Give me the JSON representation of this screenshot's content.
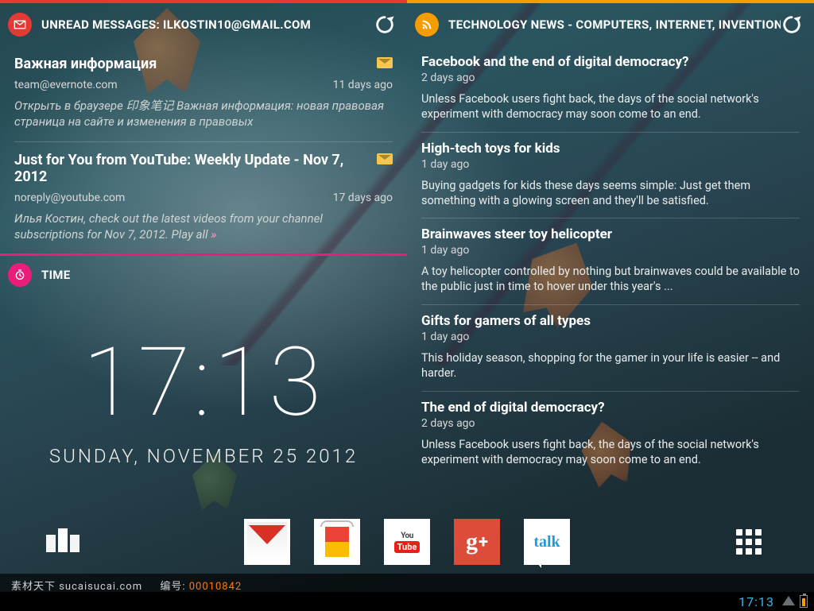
{
  "left": {
    "messages": {
      "header": "UNREAD MESSAGES: ILKOSTIN10@GMAIL.COM",
      "items": [
        {
          "title": "Важная информация",
          "from": "team@evernote.com",
          "age": "11 days ago",
          "preview": "Открыть в браузере 印象笔记 Важная информация: новая правовая страница на сайте и изменения в правовых"
        },
        {
          "title": "Just for You from YouTube: Weekly Update - Nov 7, 2012",
          "from": "noreply@youtube.com",
          "age": "17 days ago",
          "preview": "Илья Костин, check out the latest videos from your channel subscriptions for Nov 7, 2012. Play all",
          "more": " »"
        }
      ]
    },
    "time": {
      "header": "TIME",
      "clock": "17:13",
      "date": "SUNDAY, NOVEMBER 25 2012"
    }
  },
  "right": {
    "news": {
      "header": "TECHNOLOGY NEWS - COMPUTERS, INTERNET, INVENTION /",
      "items": [
        {
          "title": "Facebook and the end of digital democracy?",
          "age": "2 days ago",
          "summary": "Unless Facebook users fight back, the days of the social network's experiment with democracy may soon come to an end."
        },
        {
          "title": "High-tech toys for kids",
          "age": "1 day ago",
          "summary": "Buying gadgets for kids these days seems simple: Just get them something with a glowing screen and they'll be satisfied."
        },
        {
          "title": "Brainwaves steer toy helicopter",
          "age": "1 day ago",
          "summary": "A toy helicopter controlled by nothing but brainwaves could be available to the public just in time to hover under this year's ..."
        },
        {
          "title": "Gifts for gamers of all types",
          "age": "1 day ago",
          "summary": "This holiday season, shopping for the gamer in your life is easier -- and harder."
        },
        {
          "title": "The end of digital democracy?",
          "age": "2 days ago",
          "summary": "Unless Facebook users fight back, the days of the social network's experiment with democracy may soon come to an end."
        }
      ]
    }
  },
  "dock": {
    "apps": [
      {
        "id": "gmail",
        "name": "Gmail"
      },
      {
        "id": "play",
        "name": "Play Store"
      },
      {
        "id": "youtube",
        "name": "YouTube",
        "top": "You",
        "bot": "Tube"
      },
      {
        "id": "gplus",
        "name": "Google+",
        "g": "g",
        "p": "+"
      },
      {
        "id": "talk",
        "name": "Talk",
        "label": "talk"
      }
    ]
  },
  "watermark": {
    "site": "素材天下 sucaisucai.com",
    "label": "编号:",
    "num": "00010842"
  },
  "statusbar": {
    "time": "17:13"
  }
}
